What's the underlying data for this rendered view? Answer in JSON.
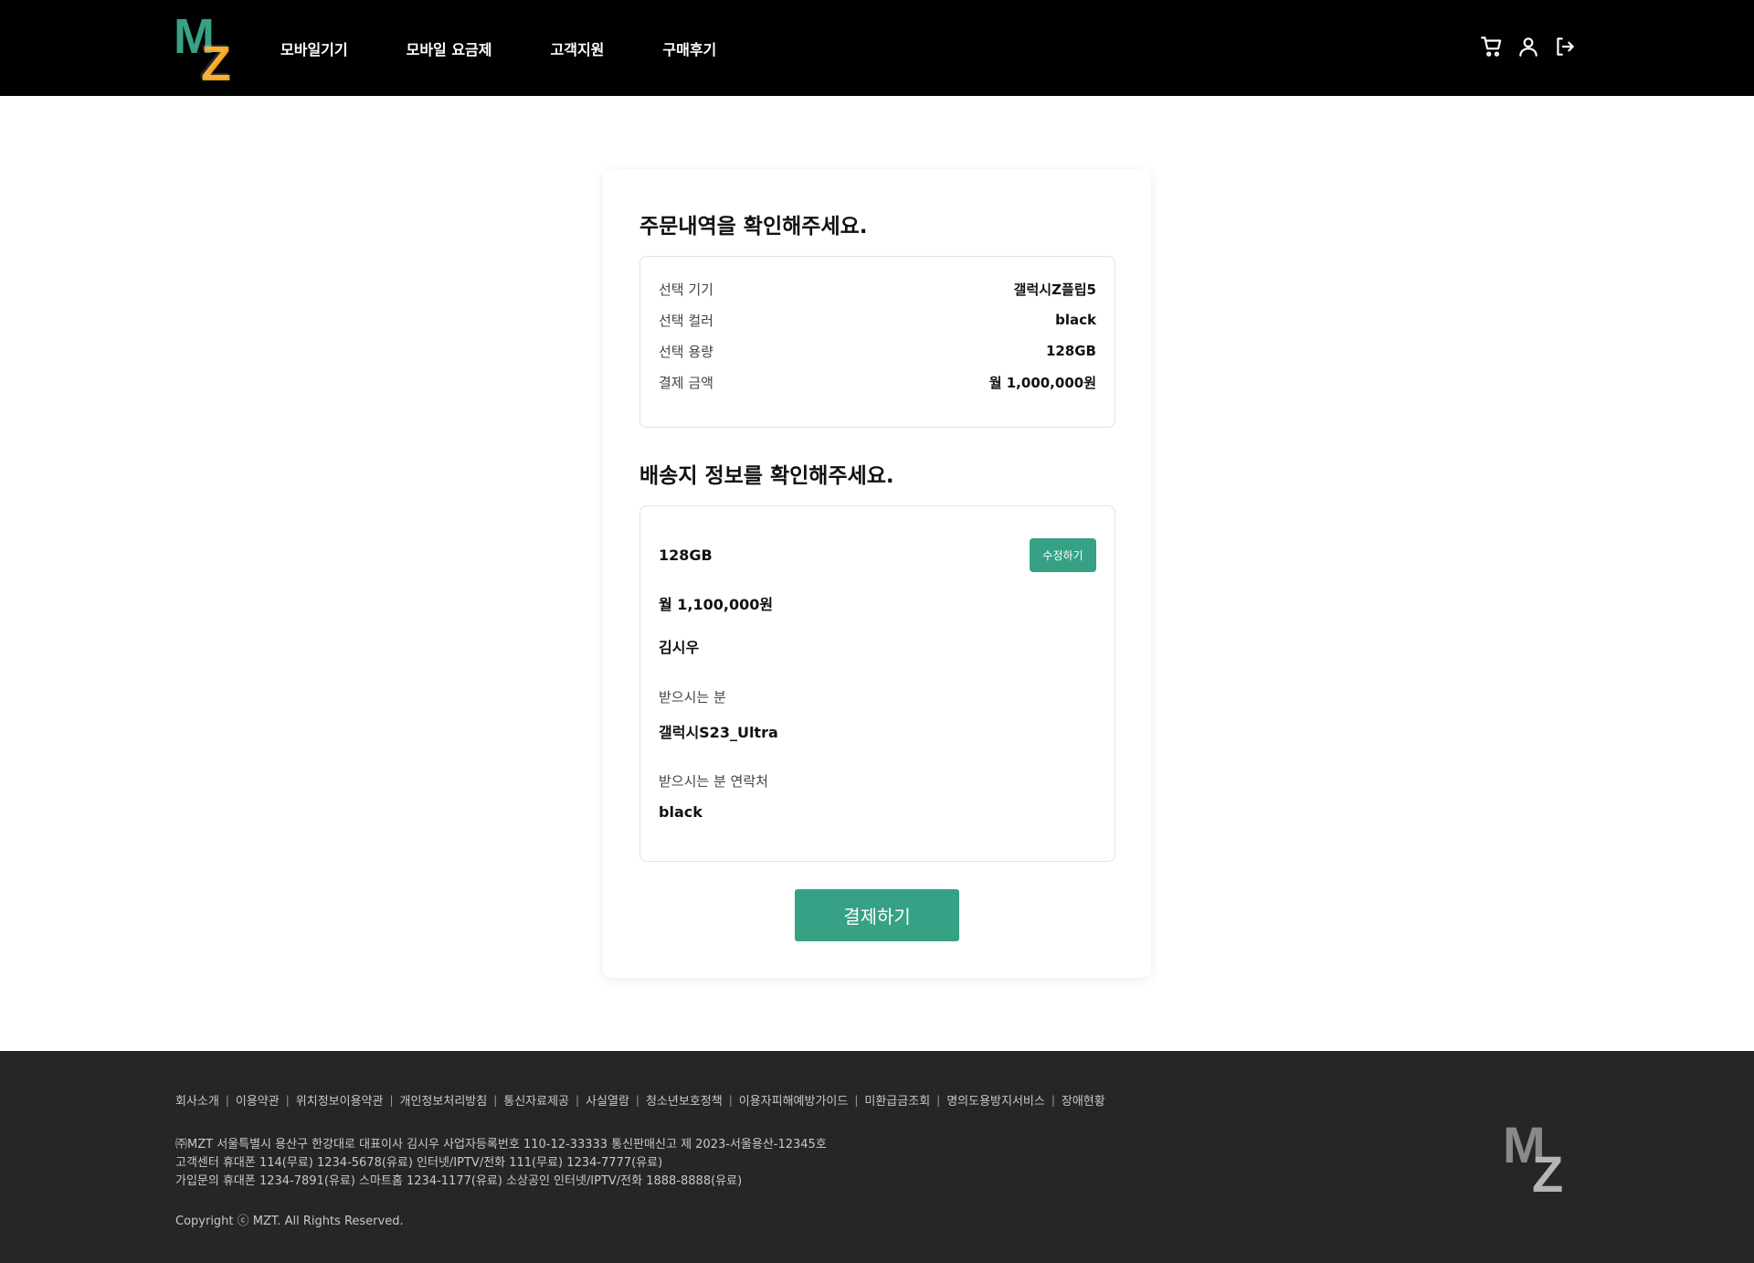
{
  "header": {
    "logo_text": "MZ",
    "nav": [
      "모바일기기",
      "모바일 요금제",
      "고객지원",
      "구매후기"
    ],
    "icons": [
      "cart-icon",
      "user-icon",
      "logout-icon"
    ]
  },
  "order": {
    "title": "주문내역을 확인해주세요.",
    "rows": [
      {
        "label": "선택 기기",
        "value": "갤럭시Z플립5"
      },
      {
        "label": "선택 컬러",
        "value": "black"
      },
      {
        "label": "선택 용량",
        "value": "128GB"
      },
      {
        "label": "결제 금액",
        "value": "월 1,000,000원"
      }
    ]
  },
  "shipping": {
    "title": "배송지 정보를 확인해주세요.",
    "line1": "128GB",
    "edit_label": "수정하기",
    "line2": "월 1,100,000원",
    "name": "김시우",
    "recipient_label": "받으시는 분",
    "recipient_value": "갤럭시S23_Ultra",
    "contact_label": "받으시는 분 연락처",
    "contact_value": "black"
  },
  "pay_label": "결제하기",
  "footer": {
    "links": [
      "회사소개",
      "이용약관",
      "위치정보이용약관",
      "개인정보처리방침",
      "통신자료제공",
      "사실열람",
      "청소년보호정책",
      "이용자피해예방가이드",
      "미환급금조회",
      "명의도용방지서비스",
      "장애현황"
    ],
    "info": [
      "㈜MZT 서울특별시 용산구 한강대로 대표이사 김시우 사업자등록번호 110-12-33333 통신판매신고 제 2023-서울용산-12345호",
      "고객센터 휴대폰 114(무료) 1234-5678(유료) 인터넷/IPTV/전화 111(무료) 1234-7777(유료)",
      "가입문의 휴대폰 1234-7891(유료) 스마트홈 1234-1177(유료) 소상공인 인터넷/IPTV/전화 1888-8888(유료)"
    ],
    "copyright": "Copyright ⓒ MZT. All Rights Reserved.",
    "logo_text": "MZ"
  },
  "colors": {
    "accent": "#36a185",
    "logo_orange": "#f5a31a",
    "header_bg": "#000000",
    "footer_bg": "#262626"
  }
}
